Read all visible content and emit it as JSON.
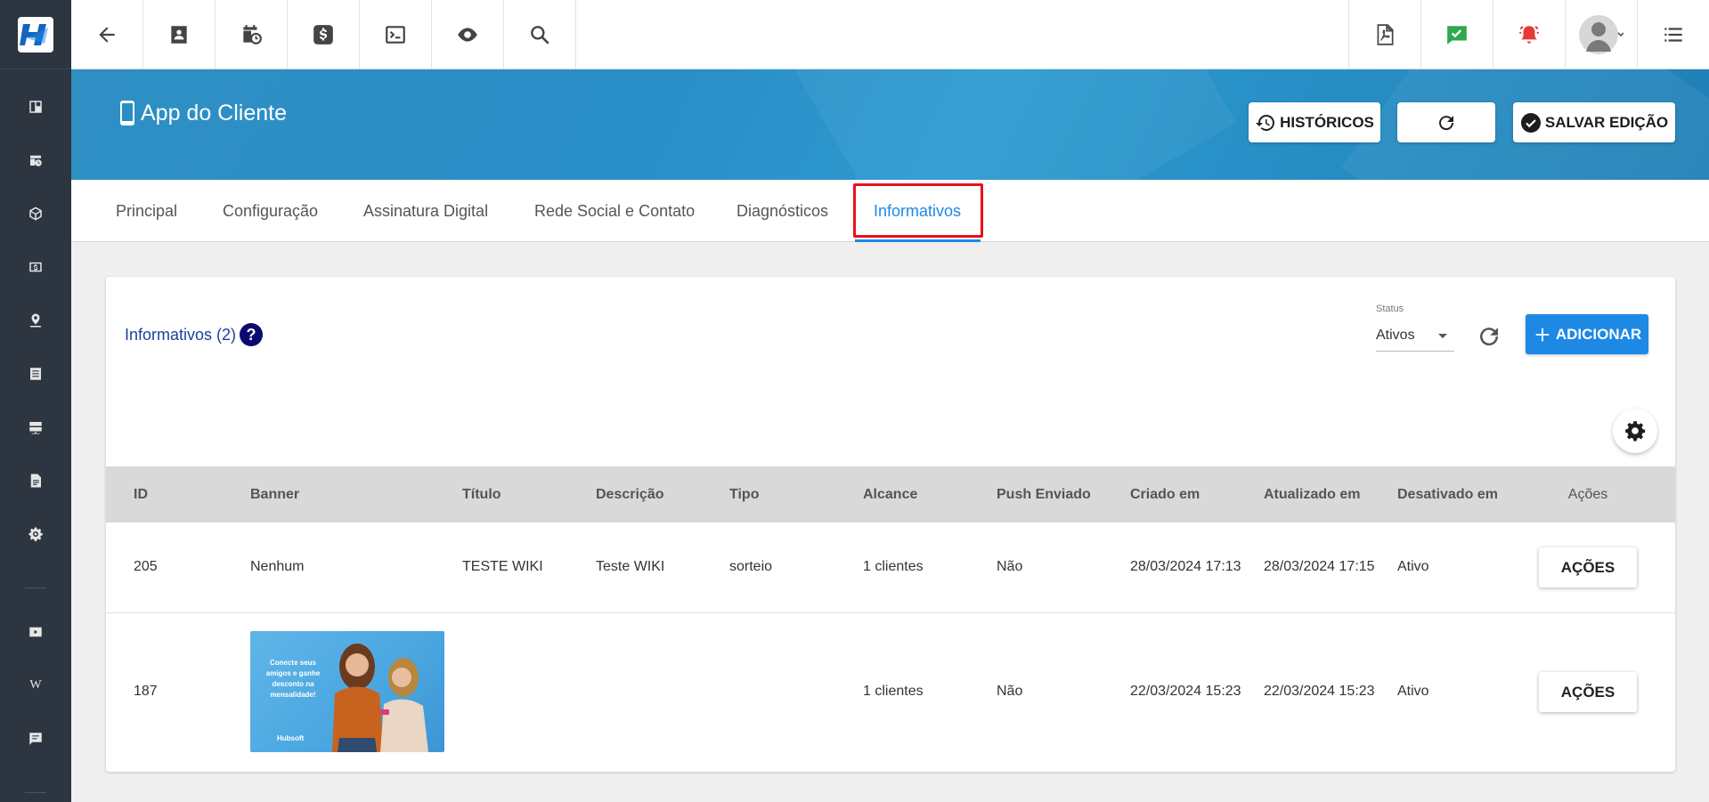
{
  "app": {
    "title": "App do Cliente"
  },
  "header_buttons": {
    "historicos": "HISTÓRICOS",
    "salvar": "SALVAR EDIÇÃO"
  },
  "tabs": [
    {
      "label": "Principal"
    },
    {
      "label": "Configuração"
    },
    {
      "label": "Assinatura Digital"
    },
    {
      "label": "Rede Social e Contato"
    },
    {
      "label": "Diagnósticos"
    },
    {
      "label": "Informativos"
    }
  ],
  "active_tab": "Informativos",
  "card": {
    "title": "Informativos (2)",
    "help": "?",
    "status_label": "Status",
    "status_value": "Ativos",
    "add_label": "ADICIONAR"
  },
  "table": {
    "headers": [
      "ID",
      "Banner",
      "Título",
      "Descrição",
      "Tipo",
      "Alcance",
      "Push Enviado",
      "Criado em",
      "Atualizado em",
      "Desativado em",
      "Ações"
    ],
    "rows": [
      {
        "id": "205",
        "banner": "Nenhum",
        "titulo": "TESTE WIKI",
        "descricao": "Teste WIKI",
        "tipo": "sorteio",
        "alcance": "1 clientes",
        "push": "Não",
        "criado": "28/03/2024 17:13",
        "atualizado": "28/03/2024 17:15",
        "desativado": "Ativo",
        "acoes": "AÇÕES"
      },
      {
        "id": "187",
        "banner": "",
        "titulo": "",
        "descricao": "",
        "tipo": "",
        "alcance": "1 clientes",
        "push": "Não",
        "criado": "22/03/2024 15:23",
        "atualizado": "22/03/2024 15:23",
        "desativado": "Ativo",
        "acoes": "AÇÕES",
        "banner_image": {
          "text": "Conecte seus amigos e ganhe desconto na mensalidade!",
          "brand": "Hubsoft"
        }
      }
    ]
  },
  "colors": {
    "accent": "#1e88e5",
    "sidebar": "#2d3540",
    "highlight": "#e8111b",
    "check_green": "#2fa84f",
    "alert_red": "#e53935"
  },
  "icons": {
    "sidebar": [
      "dashboard-icon",
      "calendar-clock-icon",
      "box-icon",
      "money-icon",
      "map-pin-icon",
      "list-icon",
      "server-icon",
      "document-icon",
      "gear-icon",
      "youtube-icon",
      "wiki-icon",
      "chat-icon"
    ],
    "sidebar_wiki_glyph": "W",
    "topbar": [
      "back-arrow-icon",
      "contact-card-icon",
      "calendar-clock-icon",
      "dollar-icon",
      "terminal-icon",
      "eye-icon",
      "search-icon",
      "pdf-icon",
      "check-chat-icon",
      "alarm-icon",
      "avatar-icon",
      "menu-list-icon"
    ]
  }
}
